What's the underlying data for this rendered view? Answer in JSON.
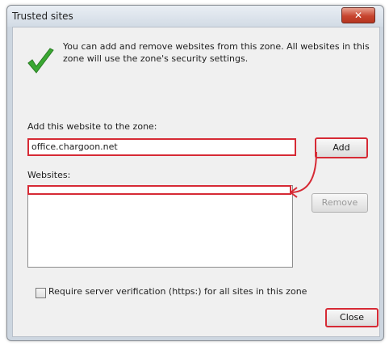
{
  "dialog": {
    "title": "Trusted sites",
    "close_glyph": "✕",
    "info_text": "You can add and remove websites from this zone. All websites in this zone will use the zone's security settings.",
    "add_label": "Add this website to the zone:",
    "url_value": "office.chargoon.net",
    "add_button": "Add",
    "websites_label": "Websites:",
    "remove_button": "Remove",
    "checkbox_label": "Require server verification (https:) for all sites in this zone",
    "close_button": "Close"
  },
  "colors": {
    "highlight": "#d62a35",
    "check_green": "#3aa832"
  },
  "icons": {
    "info": "checkmark-icon",
    "title_close": "close-icon"
  }
}
